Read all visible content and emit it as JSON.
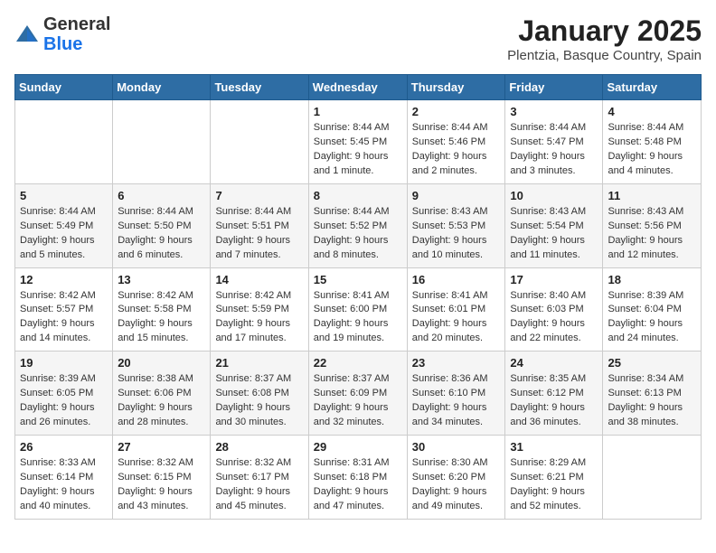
{
  "logo": {
    "general": "General",
    "blue": "Blue"
  },
  "header": {
    "title": "January 2025",
    "location": "Plentzia, Basque Country, Spain"
  },
  "days_of_week": [
    "Sunday",
    "Monday",
    "Tuesday",
    "Wednesday",
    "Thursday",
    "Friday",
    "Saturday"
  ],
  "weeks": [
    [
      {
        "day": "",
        "info": ""
      },
      {
        "day": "",
        "info": ""
      },
      {
        "day": "",
        "info": ""
      },
      {
        "day": "1",
        "info": "Sunrise: 8:44 AM\nSunset: 5:45 PM\nDaylight: 9 hours and 1 minute."
      },
      {
        "day": "2",
        "info": "Sunrise: 8:44 AM\nSunset: 5:46 PM\nDaylight: 9 hours and 2 minutes."
      },
      {
        "day": "3",
        "info": "Sunrise: 8:44 AM\nSunset: 5:47 PM\nDaylight: 9 hours and 3 minutes."
      },
      {
        "day": "4",
        "info": "Sunrise: 8:44 AM\nSunset: 5:48 PM\nDaylight: 9 hours and 4 minutes."
      }
    ],
    [
      {
        "day": "5",
        "info": "Sunrise: 8:44 AM\nSunset: 5:49 PM\nDaylight: 9 hours and 5 minutes."
      },
      {
        "day": "6",
        "info": "Sunrise: 8:44 AM\nSunset: 5:50 PM\nDaylight: 9 hours and 6 minutes."
      },
      {
        "day": "7",
        "info": "Sunrise: 8:44 AM\nSunset: 5:51 PM\nDaylight: 9 hours and 7 minutes."
      },
      {
        "day": "8",
        "info": "Sunrise: 8:44 AM\nSunset: 5:52 PM\nDaylight: 9 hours and 8 minutes."
      },
      {
        "day": "9",
        "info": "Sunrise: 8:43 AM\nSunset: 5:53 PM\nDaylight: 9 hours and 10 minutes."
      },
      {
        "day": "10",
        "info": "Sunrise: 8:43 AM\nSunset: 5:54 PM\nDaylight: 9 hours and 11 minutes."
      },
      {
        "day": "11",
        "info": "Sunrise: 8:43 AM\nSunset: 5:56 PM\nDaylight: 9 hours and 12 minutes."
      }
    ],
    [
      {
        "day": "12",
        "info": "Sunrise: 8:42 AM\nSunset: 5:57 PM\nDaylight: 9 hours and 14 minutes."
      },
      {
        "day": "13",
        "info": "Sunrise: 8:42 AM\nSunset: 5:58 PM\nDaylight: 9 hours and 15 minutes."
      },
      {
        "day": "14",
        "info": "Sunrise: 8:42 AM\nSunset: 5:59 PM\nDaylight: 9 hours and 17 minutes."
      },
      {
        "day": "15",
        "info": "Sunrise: 8:41 AM\nSunset: 6:00 PM\nDaylight: 9 hours and 19 minutes."
      },
      {
        "day": "16",
        "info": "Sunrise: 8:41 AM\nSunset: 6:01 PM\nDaylight: 9 hours and 20 minutes."
      },
      {
        "day": "17",
        "info": "Sunrise: 8:40 AM\nSunset: 6:03 PM\nDaylight: 9 hours and 22 minutes."
      },
      {
        "day": "18",
        "info": "Sunrise: 8:39 AM\nSunset: 6:04 PM\nDaylight: 9 hours and 24 minutes."
      }
    ],
    [
      {
        "day": "19",
        "info": "Sunrise: 8:39 AM\nSunset: 6:05 PM\nDaylight: 9 hours and 26 minutes."
      },
      {
        "day": "20",
        "info": "Sunrise: 8:38 AM\nSunset: 6:06 PM\nDaylight: 9 hours and 28 minutes."
      },
      {
        "day": "21",
        "info": "Sunrise: 8:37 AM\nSunset: 6:08 PM\nDaylight: 9 hours and 30 minutes."
      },
      {
        "day": "22",
        "info": "Sunrise: 8:37 AM\nSunset: 6:09 PM\nDaylight: 9 hours and 32 minutes."
      },
      {
        "day": "23",
        "info": "Sunrise: 8:36 AM\nSunset: 6:10 PM\nDaylight: 9 hours and 34 minutes."
      },
      {
        "day": "24",
        "info": "Sunrise: 8:35 AM\nSunset: 6:12 PM\nDaylight: 9 hours and 36 minutes."
      },
      {
        "day": "25",
        "info": "Sunrise: 8:34 AM\nSunset: 6:13 PM\nDaylight: 9 hours and 38 minutes."
      }
    ],
    [
      {
        "day": "26",
        "info": "Sunrise: 8:33 AM\nSunset: 6:14 PM\nDaylight: 9 hours and 40 minutes."
      },
      {
        "day": "27",
        "info": "Sunrise: 8:32 AM\nSunset: 6:15 PM\nDaylight: 9 hours and 43 minutes."
      },
      {
        "day": "28",
        "info": "Sunrise: 8:32 AM\nSunset: 6:17 PM\nDaylight: 9 hours and 45 minutes."
      },
      {
        "day": "29",
        "info": "Sunrise: 8:31 AM\nSunset: 6:18 PM\nDaylight: 9 hours and 47 minutes."
      },
      {
        "day": "30",
        "info": "Sunrise: 8:30 AM\nSunset: 6:20 PM\nDaylight: 9 hours and 49 minutes."
      },
      {
        "day": "31",
        "info": "Sunrise: 8:29 AM\nSunset: 6:21 PM\nDaylight: 9 hours and 52 minutes."
      },
      {
        "day": "",
        "info": ""
      }
    ]
  ]
}
